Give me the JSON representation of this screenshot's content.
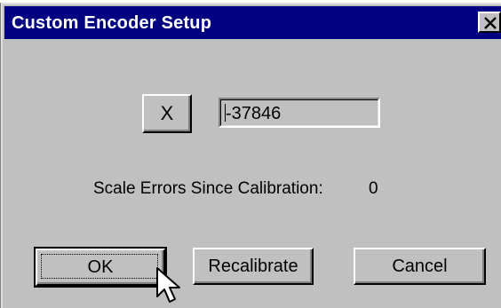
{
  "window": {
    "title": "Custom Encoder Setup",
    "close_icon": "close-icon"
  },
  "axis": {
    "button_label": "X",
    "position_value": "-37846"
  },
  "status": {
    "label": "Scale Errors Since Calibration:",
    "count": "0"
  },
  "buttons": {
    "ok": "OK",
    "recalibrate": "Recalibrate",
    "cancel": "Cancel"
  },
  "colors": {
    "titlebar": "#000080",
    "face": "#c0c0c0"
  }
}
